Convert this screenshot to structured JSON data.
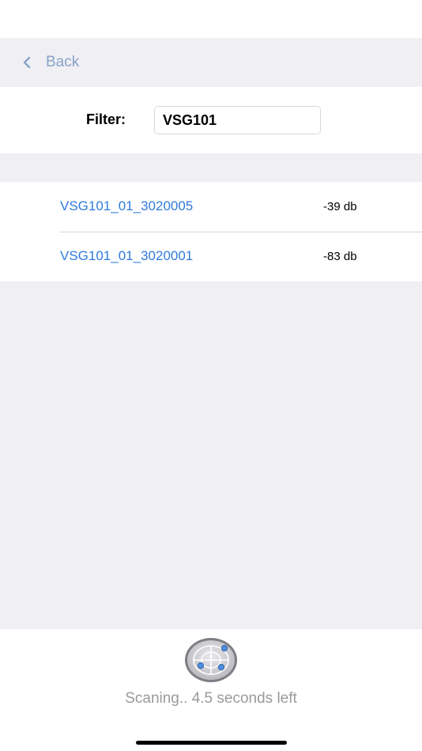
{
  "nav": {
    "back_label": "Back"
  },
  "filter": {
    "label": "Filter:",
    "value": "VSG101"
  },
  "devices": [
    {
      "name": "VSG101_01_3020005",
      "signal": "-39 db"
    },
    {
      "name": "VSG101_01_3020001",
      "signal": "-83 db"
    }
  ],
  "footer": {
    "scan_icon": "radar-icon",
    "status_text": "Scaning.. 4.5 seconds left"
  },
  "colors": {
    "link": "#2f7bdc",
    "back": "#8aa3c8",
    "background": "#efeff4",
    "status_text": "#9a9a9e"
  }
}
